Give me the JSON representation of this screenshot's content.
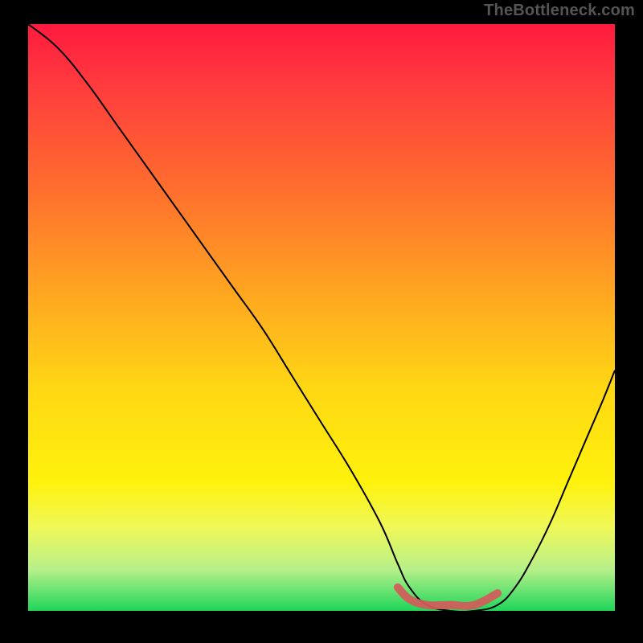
{
  "branding": {
    "watermark": "TheBottleneck.com"
  },
  "chart_data": {
    "type": "line",
    "title": "",
    "xlabel": "",
    "ylabel": "",
    "xlim": [
      0,
      100
    ],
    "ylim": [
      0,
      100
    ],
    "background_gradient": {
      "stops": [
        {
          "offset": 0.0,
          "color": "#ff1a3e"
        },
        {
          "offset": 0.1,
          "color": "#ff3a3e"
        },
        {
          "offset": 0.28,
          "color": "#ff6e2e"
        },
        {
          "offset": 0.45,
          "color": "#ffa321"
        },
        {
          "offset": 0.62,
          "color": "#ffd714"
        },
        {
          "offset": 0.78,
          "color": "#fff20c"
        },
        {
          "offset": 0.86,
          "color": "#eef85a"
        },
        {
          "offset": 0.93,
          "color": "#b6f08a"
        },
        {
          "offset": 1.0,
          "color": "#1fd65a"
        }
      ]
    },
    "series": [
      {
        "name": "bottleneck-curve",
        "x": [
          0,
          5,
          10,
          15,
          20,
          25,
          30,
          35,
          40,
          45,
          50,
          55,
          60,
          63,
          65,
          68,
          72,
          76,
          80,
          83,
          86,
          89,
          92,
          95,
          98,
          100
        ],
        "y": [
          100,
          96,
          90,
          83,
          76,
          69,
          62,
          55,
          48,
          40,
          32,
          24,
          15,
          8,
          4,
          1,
          0,
          0,
          1,
          4,
          9,
          15,
          22,
          29,
          36,
          41
        ]
      }
    ],
    "trough_highlight": {
      "x": [
        63,
        65,
        68,
        72,
        76,
        80
      ],
      "y": [
        4,
        2,
        1,
        1,
        1,
        3
      ]
    }
  }
}
